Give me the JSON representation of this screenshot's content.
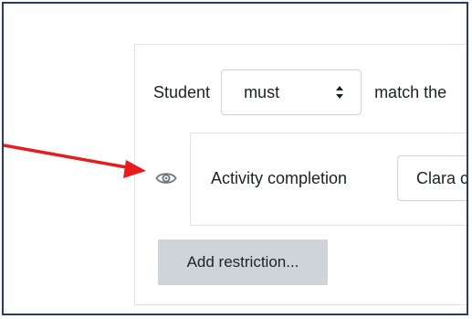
{
  "restriction": {
    "student_label": "Student",
    "match_select": {
      "value": "must"
    },
    "match_suffix": "match the"
  },
  "condition": {
    "eye_icon": "eye-icon",
    "label": "Activity completion",
    "activity_select": {
      "value": "Clara c"
    }
  },
  "add_restriction_label": "Add restriction...",
  "annotation": {
    "arrow_color": "#e81c1c"
  },
  "colors": {
    "frame_border": "#2b3a67",
    "button_bg": "#ced4da",
    "text": "#1d2125"
  }
}
